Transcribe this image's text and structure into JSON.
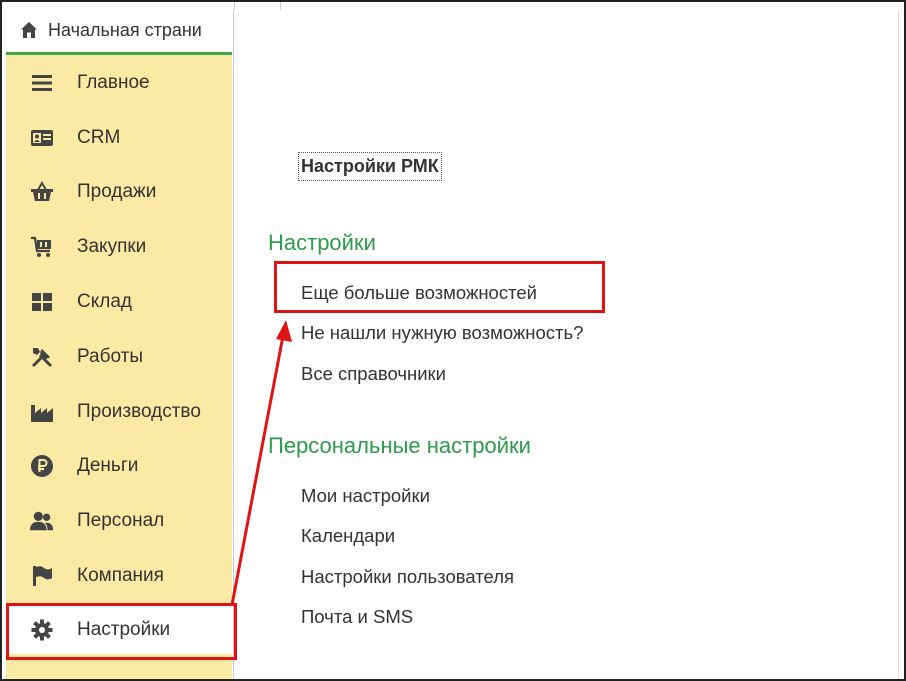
{
  "tab": {
    "label": "Начальная страни"
  },
  "sidebar": {
    "items": [
      {
        "label": "Главное",
        "icon": "menu-icon"
      },
      {
        "label": "CRM",
        "icon": "id-card-icon"
      },
      {
        "label": "Продажи",
        "icon": "basket-icon"
      },
      {
        "label": "Закупки",
        "icon": "cart-icon"
      },
      {
        "label": "Склад",
        "icon": "warehouse-icon"
      },
      {
        "label": "Работы",
        "icon": "tools-icon"
      },
      {
        "label": "Производство",
        "icon": "factory-icon"
      },
      {
        "label": "Деньги",
        "icon": "ruble-icon"
      },
      {
        "label": "Персонал",
        "icon": "people-icon"
      },
      {
        "label": "Компания",
        "icon": "flag-icon"
      },
      {
        "label": "Настройки",
        "icon": "gear-icon"
      }
    ]
  },
  "main": {
    "rmk_button": "Настройки РМК",
    "sections": [
      {
        "title": "Настройки",
        "links": [
          "Еще больше возможностей",
          "Не нашли нужную возможность?",
          "Все справочники"
        ]
      },
      {
        "title": "Персональные настройки",
        "links": [
          "Мои настройки",
          "Календари",
          "Настройки пользователя",
          "Почта и SMS"
        ]
      }
    ]
  },
  "colors": {
    "sidebar_bg": "#fbeaa3",
    "section_title": "#2d9b49",
    "highlight": "#e01414",
    "tab_underline": "#3aa84a"
  }
}
